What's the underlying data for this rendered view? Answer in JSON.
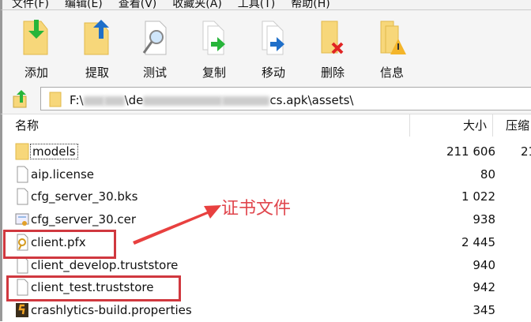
{
  "menu": [
    "文件(F)",
    "编辑(E)",
    "查看(V)",
    "收藏夹(A)",
    "工具(T)",
    "帮助(H)"
  ],
  "toolbar": [
    {
      "label": "添加",
      "icon": "add-icon"
    },
    {
      "label": "提取",
      "icon": "extract-icon"
    },
    {
      "label": "测试",
      "icon": "test-icon"
    },
    {
      "label": "复制",
      "icon": "copy-icon"
    },
    {
      "label": "移动",
      "icon": "move-icon"
    },
    {
      "label": "删除",
      "icon": "delete-icon"
    },
    {
      "label": "信息",
      "icon": "info-icon"
    }
  ],
  "address": {
    "prefix": "F:\\",
    "mid": "\\de",
    "suffix": "cs.apk\\assets\\"
  },
  "columns": {
    "name": "名称",
    "size": "大小",
    "packed": "压缩"
  },
  "files": [
    {
      "name": "models",
      "size": "211 606",
      "packed": "21",
      "type": "folder"
    },
    {
      "name": "aip.license",
      "size": "80",
      "type": "file"
    },
    {
      "name": "cfg_server_30.bks",
      "size": "1 022",
      "type": "file"
    },
    {
      "name": "cfg_server_30.cer",
      "size": "938",
      "type": "cert"
    },
    {
      "name": "client.pfx",
      "size": "2 445",
      "type": "pfx"
    },
    {
      "name": "client_develop.truststore",
      "size": "940",
      "type": "file"
    },
    {
      "name": "client_test.truststore",
      "size": "942",
      "type": "file"
    },
    {
      "name": "crashlytics-build.properties",
      "size": "345",
      "type": "properties"
    }
  ],
  "annotation": {
    "text": "证书文件",
    "color": "#e0464d"
  }
}
